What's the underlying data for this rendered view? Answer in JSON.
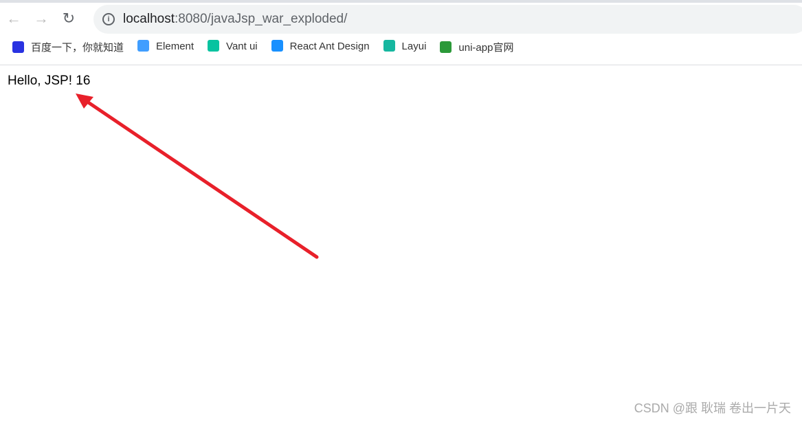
{
  "browser": {
    "url_host": "localhost",
    "url_rest": ":8080/javaJsp_war_exploded/",
    "bookmarks": [
      {
        "label": "百度一下，你就知道",
        "color": "#2932e1"
      },
      {
        "label": "Element",
        "color": "#409eff"
      },
      {
        "label": "Vant ui",
        "color": "#07c3a0"
      },
      {
        "label": "React Ant Design",
        "color": "#1890ff"
      },
      {
        "label": "Layui",
        "color": "#16b7a0"
      },
      {
        "label": "uni-app官网",
        "color": "#2b9939"
      }
    ]
  },
  "page": {
    "text": "Hello, JSP! 16"
  },
  "annotation": {
    "arrow_color": "#e8202a"
  },
  "watermark": "CSDN @跟 耿瑞 卷出一片天"
}
